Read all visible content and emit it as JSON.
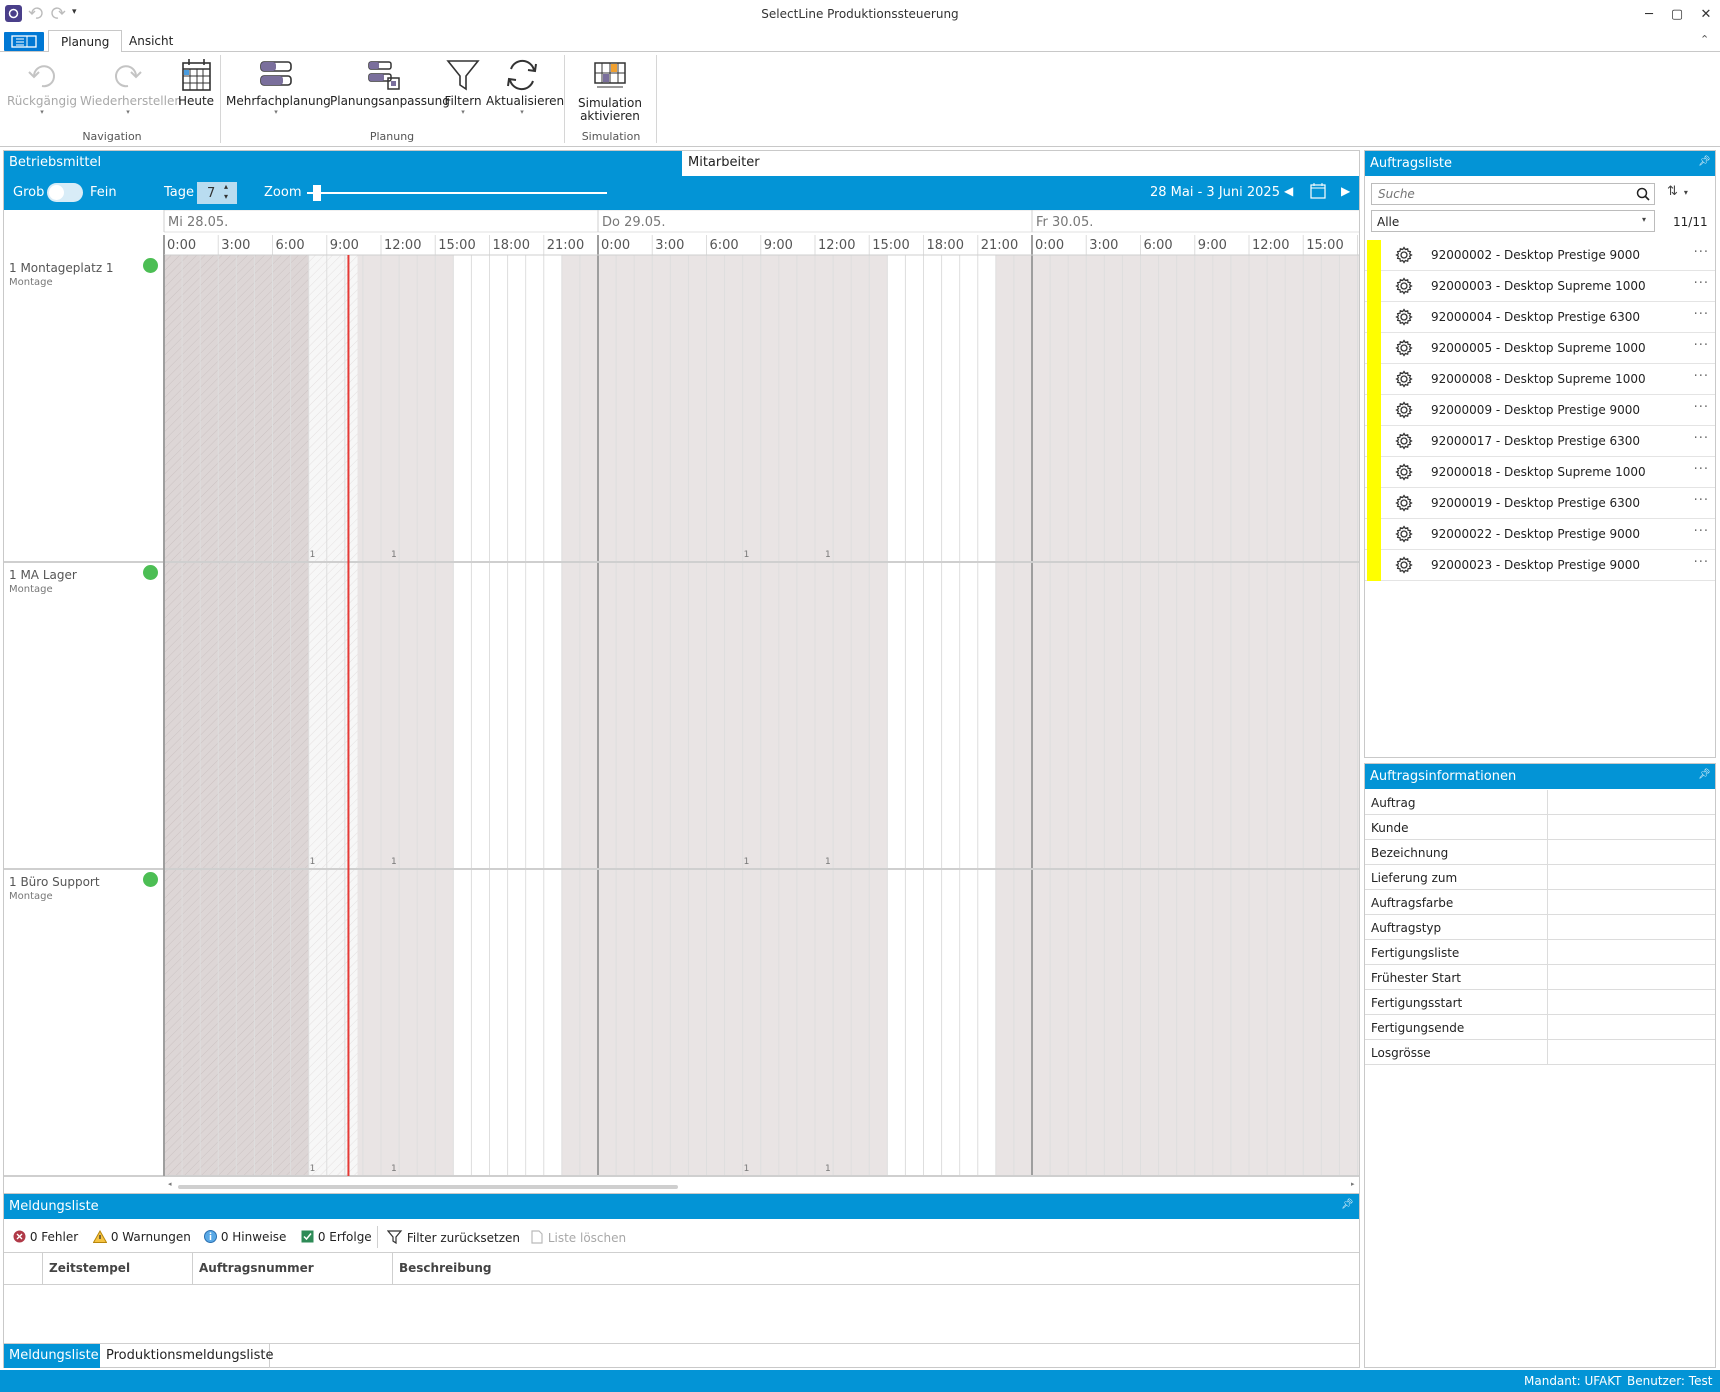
{
  "window": {
    "title": "SelectLine Produktionssteuerung"
  },
  "ribbon": {
    "tabs": [
      "Planung",
      "Ansicht"
    ],
    "buttons": {
      "undo": "Rückgängig",
      "redo": "Wiederherstellen",
      "today": "Heute",
      "multi": "Mehrfachplanung",
      "adjust": "Planungsanpassung",
      "filter": "Filtern",
      "refresh": "Aktualisieren",
      "simulation_line1": "Simulation",
      "simulation_line2": "aktivieren"
    },
    "groups": {
      "navigation": "Navigation",
      "planung": "Planung",
      "simulation": "Simulation"
    }
  },
  "scheduler": {
    "tab_betriebsmittel": "Betriebsmittel",
    "tab_mitarbeiter": "Mitarbeiter",
    "grob": "Grob",
    "fein": "Fein",
    "tage_label": "Tage",
    "tage_value": "7",
    "zoom_label": "Zoom",
    "zoom_value": 0.02,
    "date_range": "28 Mai - 3 Juni 2025",
    "days": [
      "Mi 28.05.",
      "Do 29.05.",
      "Fr 30.05."
    ],
    "hours": [
      "0:00",
      "3:00",
      "6:00",
      "9:00",
      "12:00",
      "15:00",
      "18:00",
      "21:00"
    ],
    "last_day_hours": [
      "0:00",
      "3:00",
      "6:00",
      "9:00",
      "12:00",
      "15:00"
    ],
    "marker_label": "1",
    "resources": [
      {
        "name": "1 Montageplatz 1",
        "sub": "Montage"
      },
      {
        "name": "1 MA Lager",
        "sub": "Montage"
      },
      {
        "name": "1 Büro Support",
        "sub": "Montage"
      }
    ]
  },
  "auftragsliste": {
    "title": "Auftragsliste",
    "search_placeholder": "Suche",
    "filter_value": "Alle",
    "count": "11/11",
    "color_bar": "#ffff00",
    "orders": [
      "92000002 - Desktop Prestige 9000",
      "92000003 - Desktop Supreme 1000",
      "92000004 - Desktop Prestige 6300",
      "92000005 - Desktop Supreme 1000",
      "92000008 - Desktop Supreme 1000",
      "92000009 - Desktop Prestige 9000",
      "92000017 - Desktop Prestige 6300",
      "92000018 - Desktop Supreme 1000",
      "92000019 - Desktop Prestige 6300",
      "92000022 - Desktop Prestige 9000",
      "92000023 - Desktop Prestige 9000"
    ]
  },
  "auftragsinfo": {
    "title": "Auftragsinformationen",
    "fields": [
      "Auftrag",
      "Kunde",
      "Bezeichnung",
      "Lieferung zum",
      "Auftragsfarbe",
      "Auftragstyp",
      "Fertigungsliste",
      "Frühester Start",
      "Fertigungsstart",
      "Fertigungsende",
      "Losgrösse"
    ]
  },
  "meldungsliste": {
    "title": "Meldungsliste",
    "fehler": "0 Fehler",
    "warnungen": "0 Warnungen",
    "hinweise": "0 Hinweise",
    "erfolge": "0 Erfolge",
    "filter_reset": "Filter zurücksetzen",
    "clear": "Liste löschen",
    "columns": [
      "Zeitstempel",
      "Auftragsnummer",
      "Beschreibung"
    ],
    "bottom_tabs": [
      "Meldungsliste",
      "Produktionsmeldungsliste"
    ]
  },
  "status": {
    "mandant": "Mandant:  UFAKT",
    "benutzer": "Benutzer:  Test"
  },
  "colors": {
    "accent": "#0394d6",
    "now_line": "#e53935",
    "available": "#4cbe54"
  }
}
